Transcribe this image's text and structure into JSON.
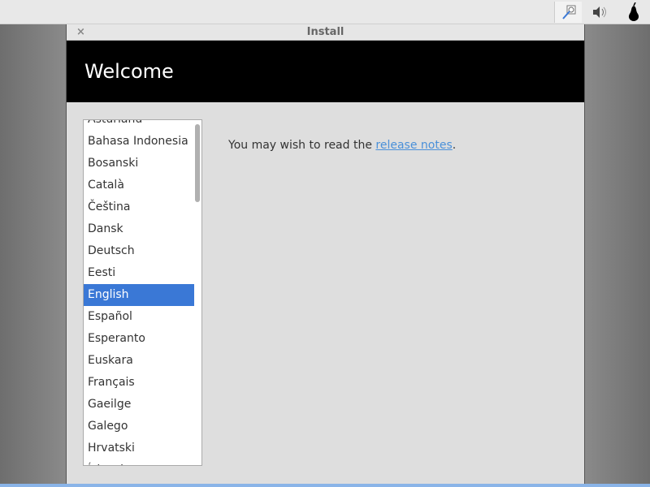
{
  "panel": {
    "icons": [
      "magnifier-icon",
      "volume-icon",
      "pear-icon"
    ]
  },
  "window": {
    "title": "Install",
    "close_label": "×"
  },
  "header": {
    "title": "Welcome"
  },
  "languages": [
    "Asturianu",
    "Bahasa Indonesia",
    "Bosanski",
    "Català",
    "Čeština",
    "Dansk",
    "Deutsch",
    "Eesti",
    "English",
    "Español",
    "Esperanto",
    "Euskara",
    "Français",
    "Gaeilge",
    "Galego",
    "Hrvatski",
    "Íslenska"
  ],
  "selected_language": "English",
  "message": {
    "prefix": "You may wish to read the ",
    "link": "release notes",
    "suffix": "."
  },
  "colors": {
    "selection": "#3a78d6",
    "link": "#4a90d9",
    "header_bg": "#000000"
  }
}
